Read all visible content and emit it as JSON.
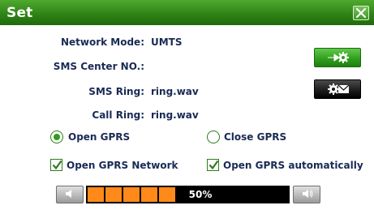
{
  "window": {
    "title": "Set"
  },
  "fields": [
    {
      "label": "Network Mode:",
      "value": "UMTS"
    },
    {
      "label": "SMS Center NO.:",
      "value": ""
    },
    {
      "label": "SMS Ring:",
      "value": "ring.wav"
    },
    {
      "label": "Call Ring:",
      "value": "ring.wav"
    }
  ],
  "gprs": {
    "open_label": "Open GPRS",
    "close_label": "Close GPRS",
    "selected": "open"
  },
  "options": {
    "network_label": "Open GPRS Network",
    "network_checked": true,
    "auto_label": "Open GPRS automatically",
    "auto_checked": true
  },
  "volume": {
    "level_text": "50%",
    "level": 0.5,
    "segments_filled": 5
  },
  "icons": {
    "close": "close-icon",
    "settings_button": "gear-icon",
    "message_button": "envelope-gear-icon",
    "volume_down": "speaker-low-icon",
    "volume_up": "speaker-high-icon"
  },
  "colors": {
    "accent_green": "#2f9c1d",
    "label_text": "#1a2a55",
    "volume_fill": "#ff8a1a"
  }
}
